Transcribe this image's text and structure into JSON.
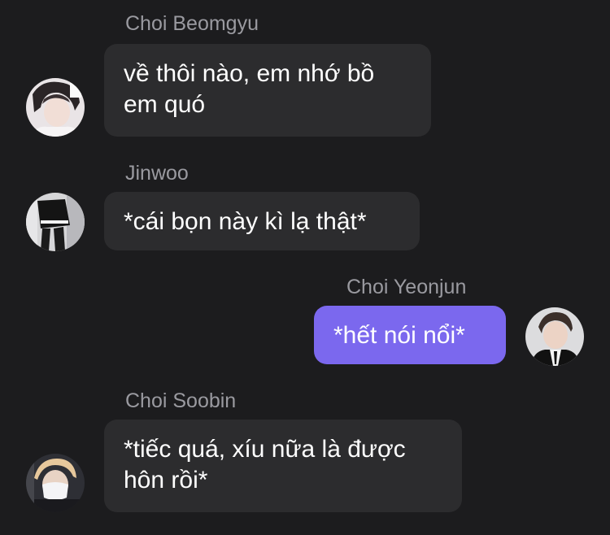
{
  "messages": [
    {
      "sender": "Choi Beomgyu",
      "text_line1": "về thôi nào, em nhớ bồ",
      "text_line2": "em quó",
      "direction": "incoming",
      "avatar": "avatar-photo-beomgyu"
    },
    {
      "sender": "Jinwoo",
      "text": "*cái bọn này kì lạ thật*",
      "direction": "incoming",
      "avatar": "avatar-photo-jinwoo"
    },
    {
      "sender": "Choi Yeonjun",
      "text": "*hết nói nổi*",
      "direction": "outgoing",
      "avatar": "avatar-photo-yeonjun"
    },
    {
      "sender": "Choi Soobin",
      "text_line1": "*tiếc quá, xíu nữa là được",
      "text_line2": "hôn rồi*",
      "direction": "incoming",
      "avatar": "avatar-photo-soobin"
    }
  ],
  "colors": {
    "background": "#1c1c1e",
    "incoming_bubble": "#2c2c2e",
    "outgoing_bubble": "#7b68ee",
    "sender_name": "#9a9aa0",
    "message_text": "#ffffff"
  }
}
